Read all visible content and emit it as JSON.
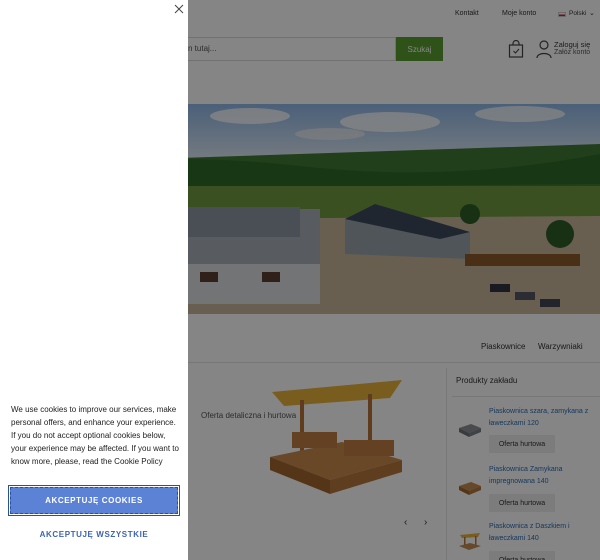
{
  "header": {
    "contact_link": "Kontakt",
    "account_link": "Moje konto",
    "language": "Polski",
    "search_placeholder": "n tutaj...",
    "search_button": "Szukaj",
    "login": "Zaloguj się",
    "register": "Załóż konto"
  },
  "categories": [
    "Piaskownice",
    "Warzywniaki"
  ],
  "promo": {
    "text": "Oferta detaliczna i hurtowa"
  },
  "sidebar": {
    "title": "Produkty zakładu",
    "products": [
      {
        "name": "Piaskownica szara, zamykana z ławeczkami 120",
        "button": "Oferta hurtowa"
      },
      {
        "name": "Piaskownica Zamykana impregnowana 140",
        "button": "Oferta hurtowa"
      },
      {
        "name": "Piaskownica z Daszkiem i ławeczkami 140",
        "button": "Oferta hurtowa"
      }
    ]
  },
  "cookie": {
    "text": "We use cookies to improve our services, make personal offers, and enhance your experience. If you do not accept optional cookies below, your experience may be affected. If you want to know more, please, read the Cookie Policy",
    "accept_button": "AKCEPTUJĘ COOKIES",
    "accept_all_button": "AKCEPTUJĘ WSZYSTKIE"
  },
  "colors": {
    "search_button": "#5a9e2f",
    "accept_button": "#5b82d5",
    "accept_all_text": "#3e63b5",
    "product_link": "#2a6bb5"
  },
  "icons": [
    "close-icon",
    "cart-icon",
    "user-icon",
    "chevron-down-icon",
    "chevron-left-icon",
    "chevron-right-icon"
  ]
}
